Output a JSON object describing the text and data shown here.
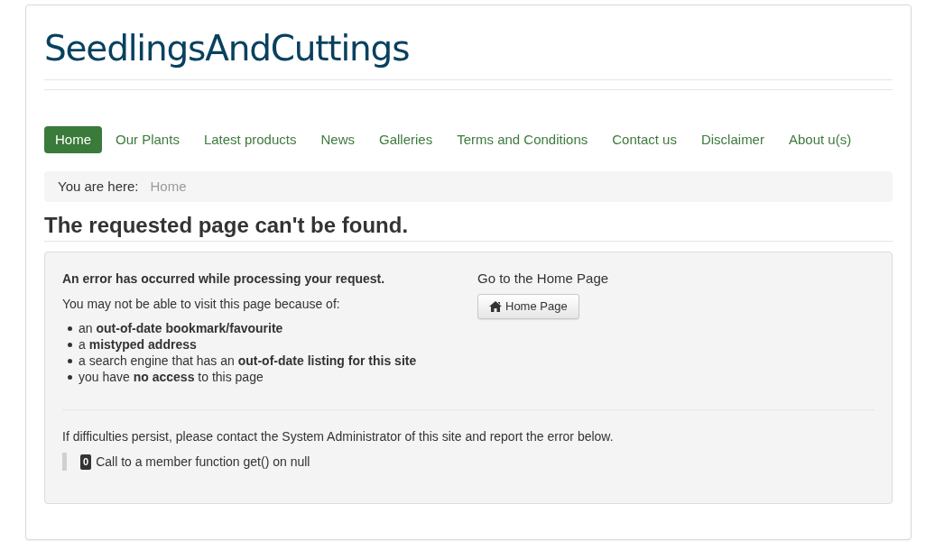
{
  "site_title": "SeedlingsAndCuttings",
  "nav": [
    {
      "label": "Home",
      "selected": true
    },
    {
      "label": "Our Plants",
      "selected": false
    },
    {
      "label": "Latest products",
      "selected": false
    },
    {
      "label": "News",
      "selected": false
    },
    {
      "label": "Galleries",
      "selected": false
    },
    {
      "label": "Terms and Conditions",
      "selected": false
    },
    {
      "label": "Contact us",
      "selected": false
    },
    {
      "label": "Disclaimer",
      "selected": false
    },
    {
      "label": "About u(s)",
      "selected": false
    }
  ],
  "breadcrumb": {
    "label": "You are here:",
    "items": [
      "Home"
    ]
  },
  "page_heading": "The requested page can't be found.",
  "error_panel": {
    "title": "An error has occurred while processing your request.",
    "intro": "You may not be able to visit this page because of:",
    "reasons": [
      "an **out-of-date bookmark/favourite**",
      "a **mistyped address**",
      "a search engine that has an **out-of-date listing for this site**",
      "you have **no access** to this page"
    ],
    "home_text": "Go to the Home Page",
    "home_button": "Home Page",
    "contact_note": "If difficulties persist, please contact the System Administrator of this site and report the error below.",
    "error": {
      "code": "0",
      "message": "Call to a member function get() on null"
    }
  }
}
